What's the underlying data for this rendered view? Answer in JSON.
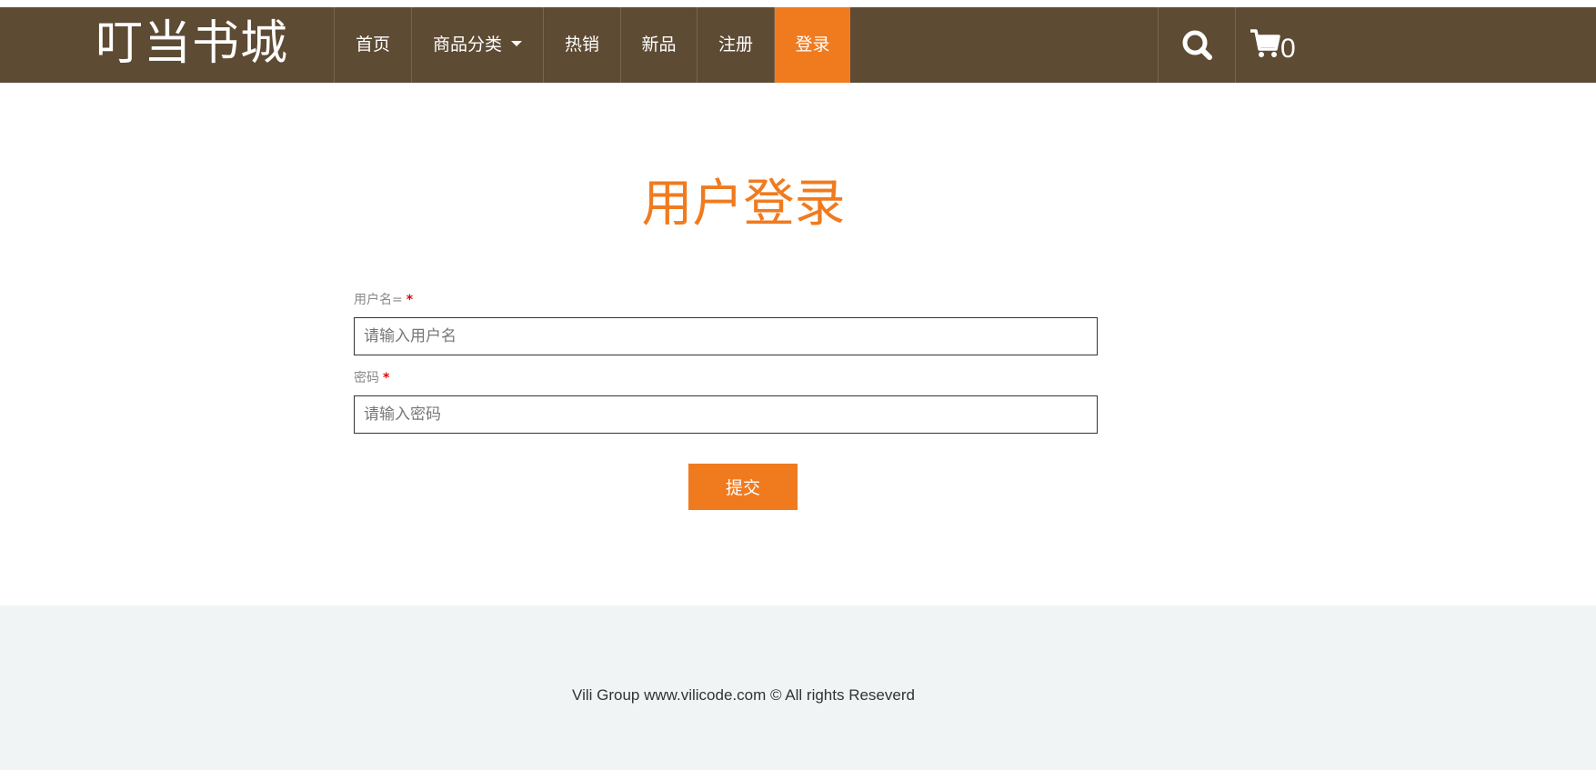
{
  "header": {
    "logo": "叮当书城",
    "nav": [
      {
        "label": "首页",
        "active": false
      },
      {
        "label": "商品分类",
        "active": false,
        "dropdown": true
      },
      {
        "label": "热销",
        "active": false
      },
      {
        "label": "新品",
        "active": false
      },
      {
        "label": "注册",
        "active": false
      },
      {
        "label": "登录",
        "active": true
      }
    ],
    "search_icon": "search-icon",
    "cart_icon": "cart-icon",
    "cart_count": "0"
  },
  "form": {
    "title": "用户登录",
    "username_label": "用户名=",
    "username_required": "*",
    "username_placeholder": "请输入用户名",
    "password_label": "密码",
    "password_required": "*",
    "password_placeholder": "请输入密码",
    "submit_label": "提交"
  },
  "footer": {
    "text": "Vili Group www.vilicode.com © All rights Reseverd"
  },
  "colors": {
    "navbar": "#5e4b34",
    "accent": "#f07b1f",
    "footer_bg": "#f0f4f4"
  }
}
